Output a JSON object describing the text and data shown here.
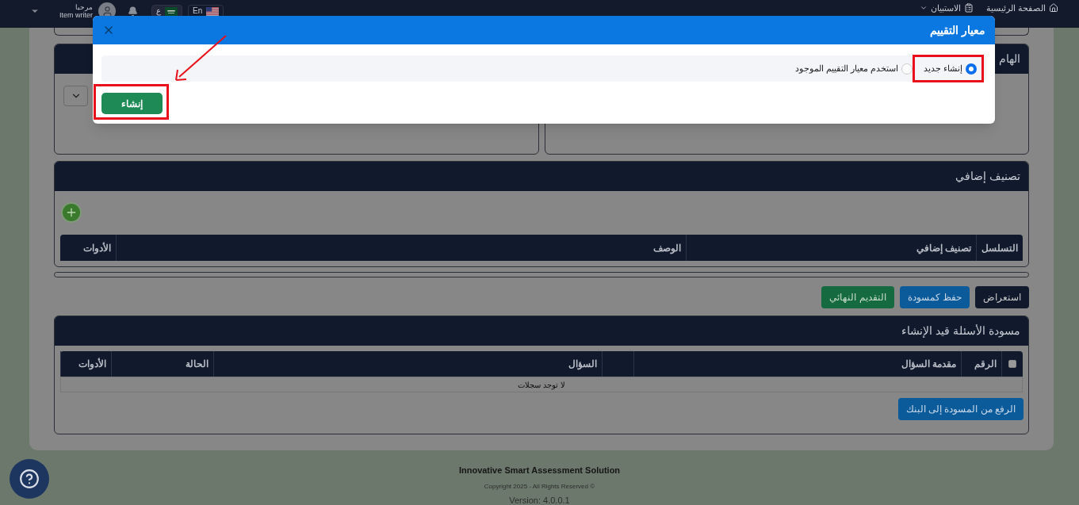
{
  "nav": {
    "links": [
      {
        "label": "الصفحة الرئيسية"
      },
      {
        "label": "الاستبيان"
      }
    ],
    "languages": [
      {
        "label": "En"
      },
      {
        "label": "ع"
      }
    ],
    "user": {
      "greeting": "مرحبا",
      "role": "Item writer"
    }
  },
  "top_panel": {
    "title": "الهام"
  },
  "classification": {
    "title": "تصنيف إضافي",
    "columns": [
      "التسلسل",
      "تصنيف إضافي",
      "الوصف",
      "الأدوات"
    ]
  },
  "actions": [
    {
      "label": "استعراض",
      "kind": "dark"
    },
    {
      "label": "حفظ كمسودة",
      "kind": "primary"
    },
    {
      "label": "التقديم النهائي",
      "kind": "success"
    }
  ],
  "drafts": {
    "title": "مسودة الأسئلة قيد الإنشاء",
    "select_all": {
      "checked": false
    },
    "columns": [
      {
        "kind": "text",
        "label": "الرقم"
      },
      {
        "kind": "text",
        "label": "مقدمة السؤال"
      },
      {
        "kind": "blank"
      },
      {
        "kind": "text",
        "label": "السؤال"
      },
      {
        "kind": "text",
        "label": "الحالة"
      },
      {
        "kind": "text",
        "label": "الأدوات"
      }
    ],
    "empty_message": "لا توجد سجلات",
    "upload_button": "الرفع من المسودة إلى البنك"
  },
  "footer": {
    "product": "Innovative Smart Assessment Solution",
    "copyright": "Copyright 2025 - All Rights Reserved ©",
    "version": "Version: 4.0.0.1"
  },
  "modal": {
    "title": "معيار التقييم",
    "options": [
      {
        "label": "إنشاء جديد",
        "selected": true
      },
      {
        "label": "استخدم معيار التقييم الموجود",
        "selected": false
      }
    ],
    "submit": "إنشاء"
  }
}
